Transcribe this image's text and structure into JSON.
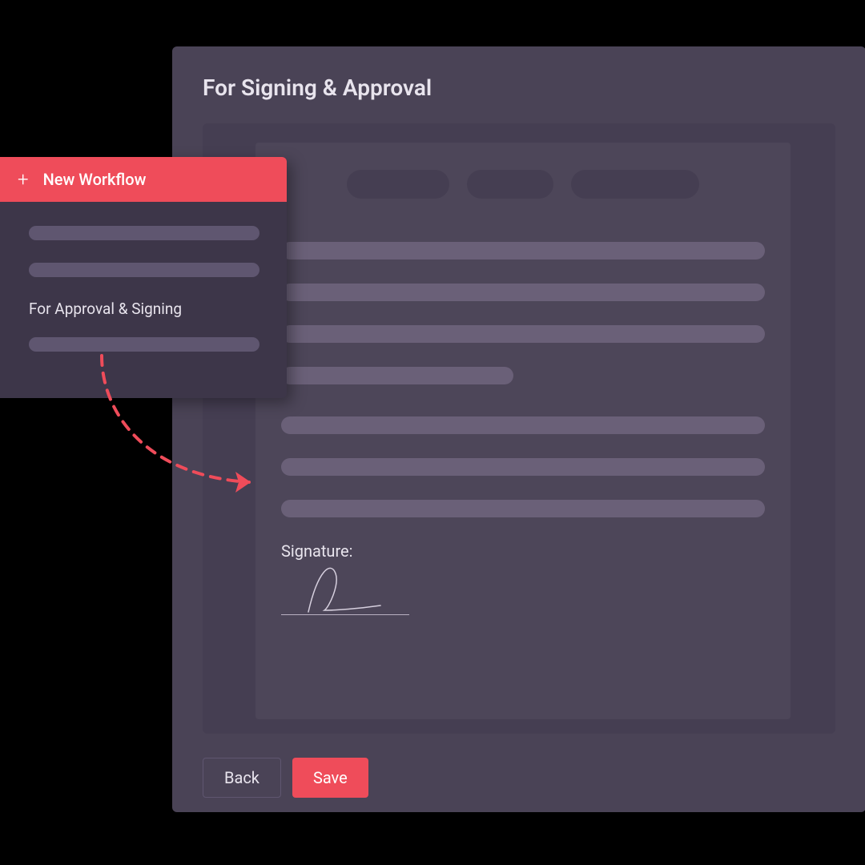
{
  "main": {
    "title": "For Signing & Approval",
    "signature_label": "Signature:",
    "buttons": {
      "back": "Back",
      "save": "Save"
    }
  },
  "sidebar": {
    "new_workflow_label": "New Workflow",
    "items": [
      null,
      null,
      "For Approval & Signing",
      null
    ]
  }
}
